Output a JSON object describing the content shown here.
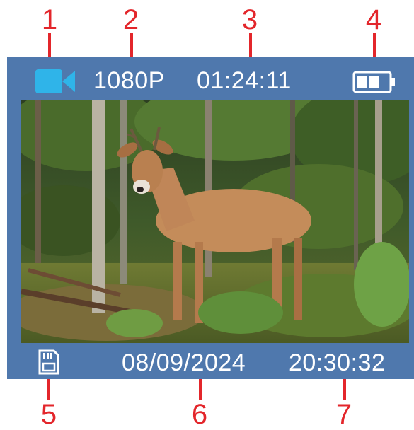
{
  "callouts": [
    "1",
    "2",
    "3",
    "4",
    "5",
    "6",
    "7"
  ],
  "status_bar": {
    "mode_icon": "video-camera-icon",
    "resolution": "1080P",
    "record_time": "01:24:11",
    "battery_icon": "battery-icon",
    "battery_level": 0.6
  },
  "preview": {
    "subject": "deer-in-forest-photo"
  },
  "info_bar": {
    "storage_icon": "sd-card-icon",
    "date": "08/09/2024",
    "time": "20:30:32"
  },
  "colors": {
    "callout": "#e3262b",
    "screen_bg": "#4f78ad",
    "camera_icon": "#2fb4e9",
    "text": "#ffffff"
  }
}
